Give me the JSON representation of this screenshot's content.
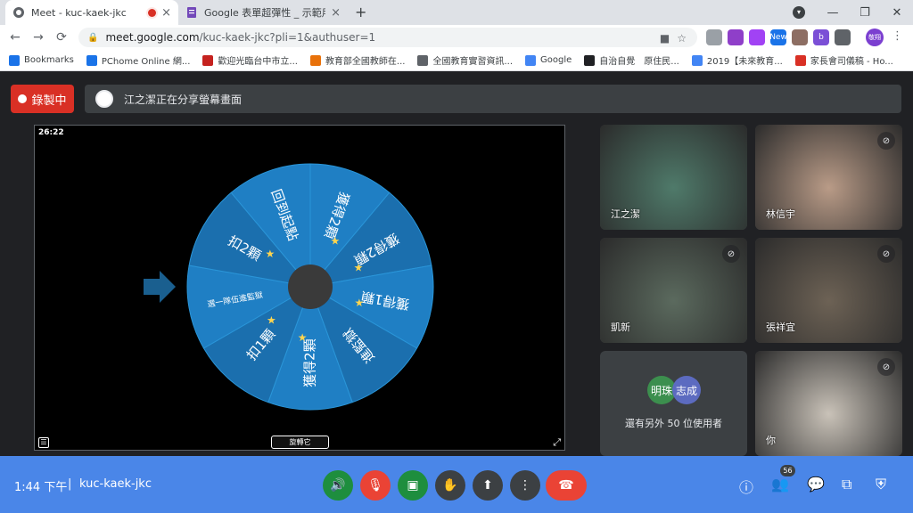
{
  "browser": {
    "tabs": [
      {
        "title": "Meet - kuc-kaek-jkc",
        "close": "×"
      },
      {
        "title": "Google 表單超彈性 _ 示範用考試",
        "close": "×"
      }
    ],
    "new_tab": "+",
    "tab_search": "▾",
    "window_controls": {
      "minimize": "—",
      "restore": "❐",
      "close": "✕"
    },
    "nav": {
      "back": "←",
      "forward": "→",
      "reload": "⟳"
    },
    "url_host": "meet.google.com",
    "url_rest": "/kuc-kaek-jkc?pli=1&authuser=1",
    "extensions": [
      {
        "label": "",
        "color": "#9aa0a6"
      },
      {
        "label": "",
        "color": "#8f3fc9"
      },
      {
        "label": "",
        "color": "#a142f4"
      },
      {
        "label": "New",
        "color": "#1a73e8"
      },
      {
        "label": "",
        "color": "#8d6e63"
      },
      {
        "label": "b",
        "color": "#7b4fd6"
      },
      {
        "label": "",
        "color": "#5f6368"
      }
    ],
    "profile_label": "敬翔",
    "menu": "⋮",
    "bookmarks": [
      {
        "label": "Bookmarks",
        "color": "#1a73e8"
      },
      {
        "label": "PChome Online 網...",
        "color": "#1a73e8"
      },
      {
        "label": "歡迎光臨台中市立...",
        "color": "#c5221f"
      },
      {
        "label": "教育部全國教師在...",
        "color": "#e8710a"
      },
      {
        "label": "全國教育實習資訊...",
        "color": "#5f6368"
      },
      {
        "label": "Google",
        "color": "#4285f4"
      },
      {
        "label": "自治自覺　原住民...",
        "color": "#202124"
      },
      {
        "label": "2019【未來教育...",
        "color": "#4285f4"
      },
      {
        "label": "家長會司儀稿 - Ho...",
        "color": "#d93025"
      }
    ]
  },
  "meet": {
    "recording_label": "錄製中",
    "presenting_text": "江之潔正在分享螢幕畫面",
    "screen": {
      "timer": "26:22",
      "spin_label": "旋轉它",
      "list_icon": "☰",
      "fullscreen_icon": "⤢",
      "arrow_color": "#1a5f8f",
      "hub_color": "#3a3a3a",
      "segments": [
        {
          "label": "獲得2顆",
          "star": true,
          "color": "#1f7fc4"
        },
        {
          "label": "獲得2顆",
          "star": true,
          "color": "#1b6fae"
        },
        {
          "label": "獲得1顆",
          "star": true,
          "color": "#1f7fc4"
        },
        {
          "label": "進監獄",
          "star": false,
          "color": "#1b6fae"
        },
        {
          "label": "獲得2顆",
          "star": true,
          "color": "#1f7fc4"
        },
        {
          "label": "扣1顆",
          "star": true,
          "color": "#1b6fae"
        },
        {
          "label": "選一隊伍進監獄",
          "star": false,
          "color": "#1f7fc4"
        },
        {
          "label": "扣2顆",
          "star": true,
          "color": "#1b6fae"
        },
        {
          "label": "回到起點",
          "star": false,
          "color": "#1f7fc4"
        }
      ]
    },
    "participants": [
      {
        "name": "江之潔",
        "muted": false,
        "bg": "#4f7a6a"
      },
      {
        "name": "林信宇",
        "muted": true,
        "bg": "#b99b87"
      },
      {
        "name": "凱新",
        "muted": true,
        "bg": "#5b6a5e"
      },
      {
        "name": "張祥宜",
        "muted": true,
        "bg": "#6d6255"
      },
      {
        "name": "你",
        "muted": true,
        "bg": "#c9c2b8"
      }
    ],
    "others": {
      "bubbles": [
        {
          "label": "明珠",
          "color": "#3c8f4e"
        },
        {
          "label": "志成",
          "color": "#5c6bc0"
        }
      ],
      "text": "還有另外 50 位使用者"
    }
  },
  "controls": {
    "clock": "1:44 下午",
    "separator": "|",
    "meeting_code": "kuc-kaek-jkc",
    "buttons": {
      "speaker": "🔊",
      "mic_off": "🎙",
      "camera": "▣",
      "hand": "✋",
      "present": "⬆",
      "more": "⋮",
      "hangup": "☎"
    },
    "right": {
      "info": "ⓘ",
      "people": "👥",
      "people_count": "56",
      "chat": "💬",
      "activities": "⧉",
      "host": "⛨"
    }
  }
}
